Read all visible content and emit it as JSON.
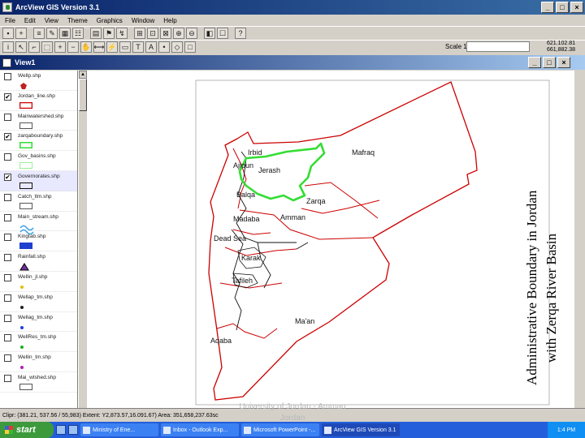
{
  "window": {
    "title": "ArcView GIS Version 3.1",
    "buttons": [
      "_",
      "□",
      "×"
    ]
  },
  "menu": [
    "File",
    "Edit",
    "View",
    "Theme",
    "Graphics",
    "Window",
    "Help"
  ],
  "toolbar": {
    "scale_label": "Scale 1:",
    "scale_value": "",
    "coord_x": "621.102.81",
    "coord_y": "661,882.38"
  },
  "view": {
    "title": "View1"
  },
  "toc": [
    {
      "label": "Wellp.shp",
      "checked": false,
      "symbol": "point-red"
    },
    {
      "label": "Jordan_line.shp",
      "checked": true,
      "symbol": "poly-red"
    },
    {
      "label": "Mainwatershed.shp",
      "checked": false,
      "symbol": "poly-gray"
    },
    {
      "label": "zarqaboundary.shp",
      "checked": true,
      "symbol": "poly-green"
    },
    {
      "label": "Gov_basins.shp",
      "checked": false,
      "symbol": "poly-lightgreen"
    },
    {
      "label": "Governorates.shp",
      "checked": true,
      "symbol": "poly-black"
    },
    {
      "label": "Catch_tlm.shp",
      "checked": false,
      "symbol": "poly-gray"
    },
    {
      "label": "Main_stream.shp",
      "checked": false,
      "symbol": "stream"
    },
    {
      "label": "Kingtab.shp",
      "checked": false,
      "symbol": "rect-blue"
    },
    {
      "label": "Rainfall.shp",
      "checked": false,
      "symbol": "triangle"
    },
    {
      "label": "Wellin_jl.shp",
      "checked": false,
      "symbol": "point-yellow"
    },
    {
      "label": "Wellap_tm.shp",
      "checked": false,
      "symbol": "point-black"
    },
    {
      "label": "Wellag_tm.shp",
      "checked": false,
      "symbol": "point-blue"
    },
    {
      "label": "WellRes_tm.shp",
      "checked": false,
      "symbol": "point-green"
    },
    {
      "label": "Wellin_tm.shp",
      "checked": false,
      "symbol": "point-purple"
    },
    {
      "label": "Mai_wtshed.shp",
      "checked": false,
      "symbol": "poly-gray"
    }
  ],
  "map": {
    "labels": [
      "Irbid",
      "Ajloun",
      "Jerash",
      "Mafraq",
      "Balqa",
      "Zarqa",
      "Madaba",
      "Amman",
      "Dead Sea",
      "Karak",
      "Tafileh",
      "Ma'an",
      "Aqaba"
    ],
    "colors": {
      "governorate_border": "#c00000",
      "zarqa_basin": "#33dd33",
      "lines": "#000000"
    }
  },
  "map_title": {
    "line1": "Administrative Boundary in Jordan",
    "line2": "with Zerqa River Basin"
  },
  "status": {
    "text": "Clipr: (381.21, 537.56 / 55,983)   Extent: Y2,873.57,16.091.67)   Area: 351,658,237.63sc"
  },
  "watermark": {
    "line1": "University of Jordan - Amman",
    "line2": "Jordan"
  },
  "taskbar": {
    "start": "start",
    "tasks": [
      "Ministry of Ene...",
      "Inbox - Outlook Exp...",
      "Microsoft PowerPoint -...",
      "ArcView GIS Version 3.1"
    ],
    "clock": "1:4 PM"
  }
}
